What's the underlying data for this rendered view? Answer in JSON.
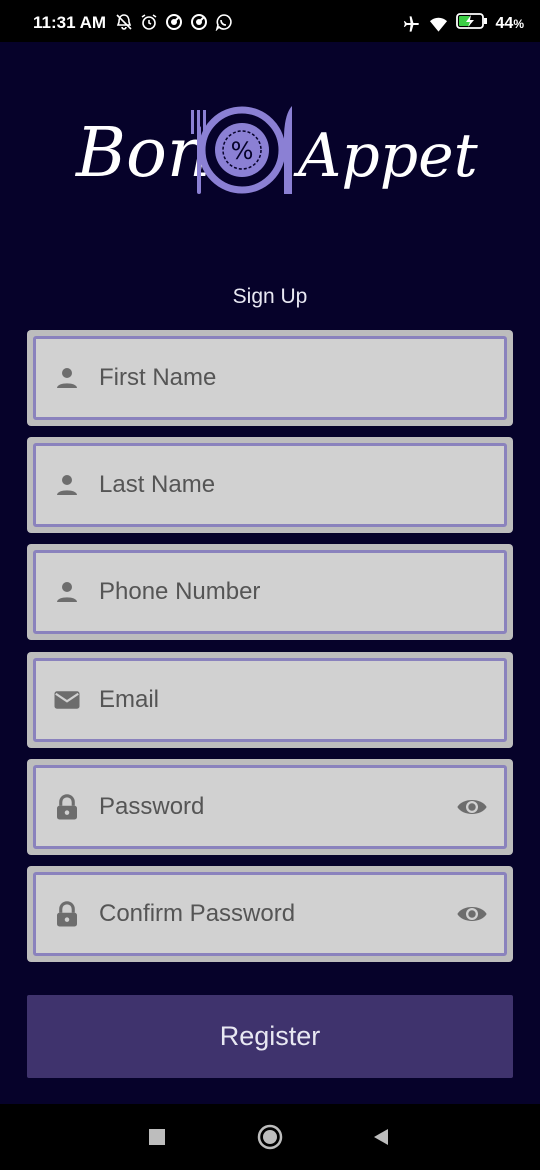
{
  "status_bar": {
    "time": "11:31 AM",
    "battery": "44",
    "battery_suffix": "%",
    "icons": [
      "mute-icon",
      "alarm-icon",
      "app-notification-icon",
      "app-notification-icon",
      "whatsapp-icon",
      "airplane-icon",
      "wifi-icon",
      "battery-charging-icon"
    ]
  },
  "app": {
    "logo_text_left": "Bon",
    "logo_text_right": "Appetit",
    "logo_badge": "%"
  },
  "form": {
    "title": "Sign Up",
    "fields": [
      {
        "label": "First Name",
        "icon": "person-icon"
      },
      {
        "label": "Last Name",
        "icon": "person-icon"
      },
      {
        "label": "Phone Number",
        "icon": "person-icon"
      },
      {
        "label": "Email",
        "icon": "mail-icon"
      },
      {
        "label": "Password",
        "icon": "lock-icon",
        "trailing_icon": "eye-icon"
      },
      {
        "label": "Confirm Password",
        "icon": "lock-icon",
        "trailing_icon": "eye-icon"
      }
    ],
    "submit_label": "Register"
  },
  "colors": {
    "background": "#06022a",
    "field_border": "#8a82bd",
    "button": "#3f336d",
    "logo_accent": "#8b80d4"
  },
  "nav_bar": {
    "buttons": [
      "recents-button",
      "home-button",
      "back-button"
    ]
  }
}
